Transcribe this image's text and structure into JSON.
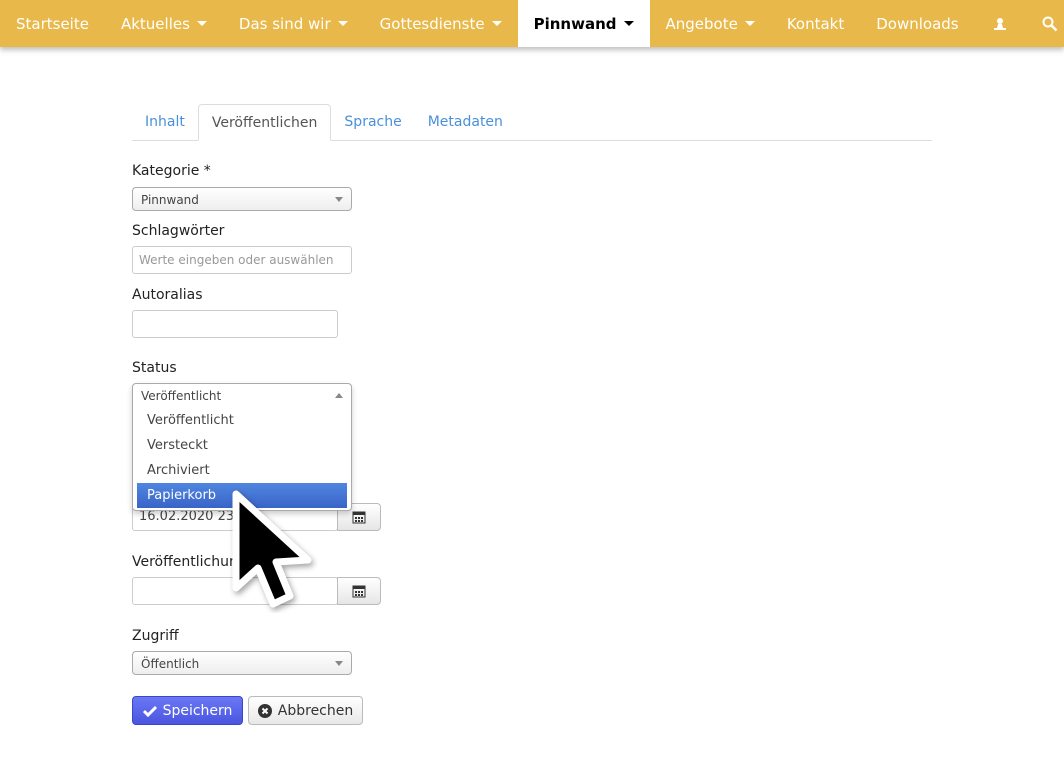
{
  "nav": {
    "items": [
      {
        "label": "Startseite",
        "caret": false
      },
      {
        "label": "Aktuelles",
        "caret": true
      },
      {
        "label": "Das sind wir",
        "caret": true
      },
      {
        "label": "Gottesdienste",
        "caret": true
      },
      {
        "label": "Pinnwand",
        "caret": true,
        "active": true
      },
      {
        "label": "Angebote",
        "caret": true
      },
      {
        "label": "Kontakt",
        "caret": false
      },
      {
        "label": "Downloads",
        "caret": false
      }
    ],
    "icons": [
      "user-icon",
      "search-icon"
    ],
    "color": "#e8b84a"
  },
  "tabs": [
    {
      "label": "Inhalt"
    },
    {
      "label": "Veröffentlichen",
      "active": true
    },
    {
      "label": "Sprache"
    },
    {
      "label": "Metadaten"
    }
  ],
  "form": {
    "category_label": "Kategorie *",
    "category_value": "Pinnwand",
    "tags_label": "Schlagwörter",
    "tags_placeholder": "Werte eingeben oder auswählen",
    "alias_label": "Autoralias",
    "alias_value": "",
    "status_label": "Status",
    "status_value": "Veröffentlicht",
    "status_options": [
      "Veröffentlicht",
      "Versteckt",
      "Archiviert",
      "Papierkorb"
    ],
    "status_highlighted": "Papierkorb",
    "publish_start_value": "16.02.2020 23:24",
    "publish_end_label": "Veröffentlichung",
    "publish_end_value": "",
    "access_label": "Zugriff",
    "access_value": "Öffentlich",
    "save_label": "Speichern",
    "cancel_label": "Abbrechen"
  }
}
